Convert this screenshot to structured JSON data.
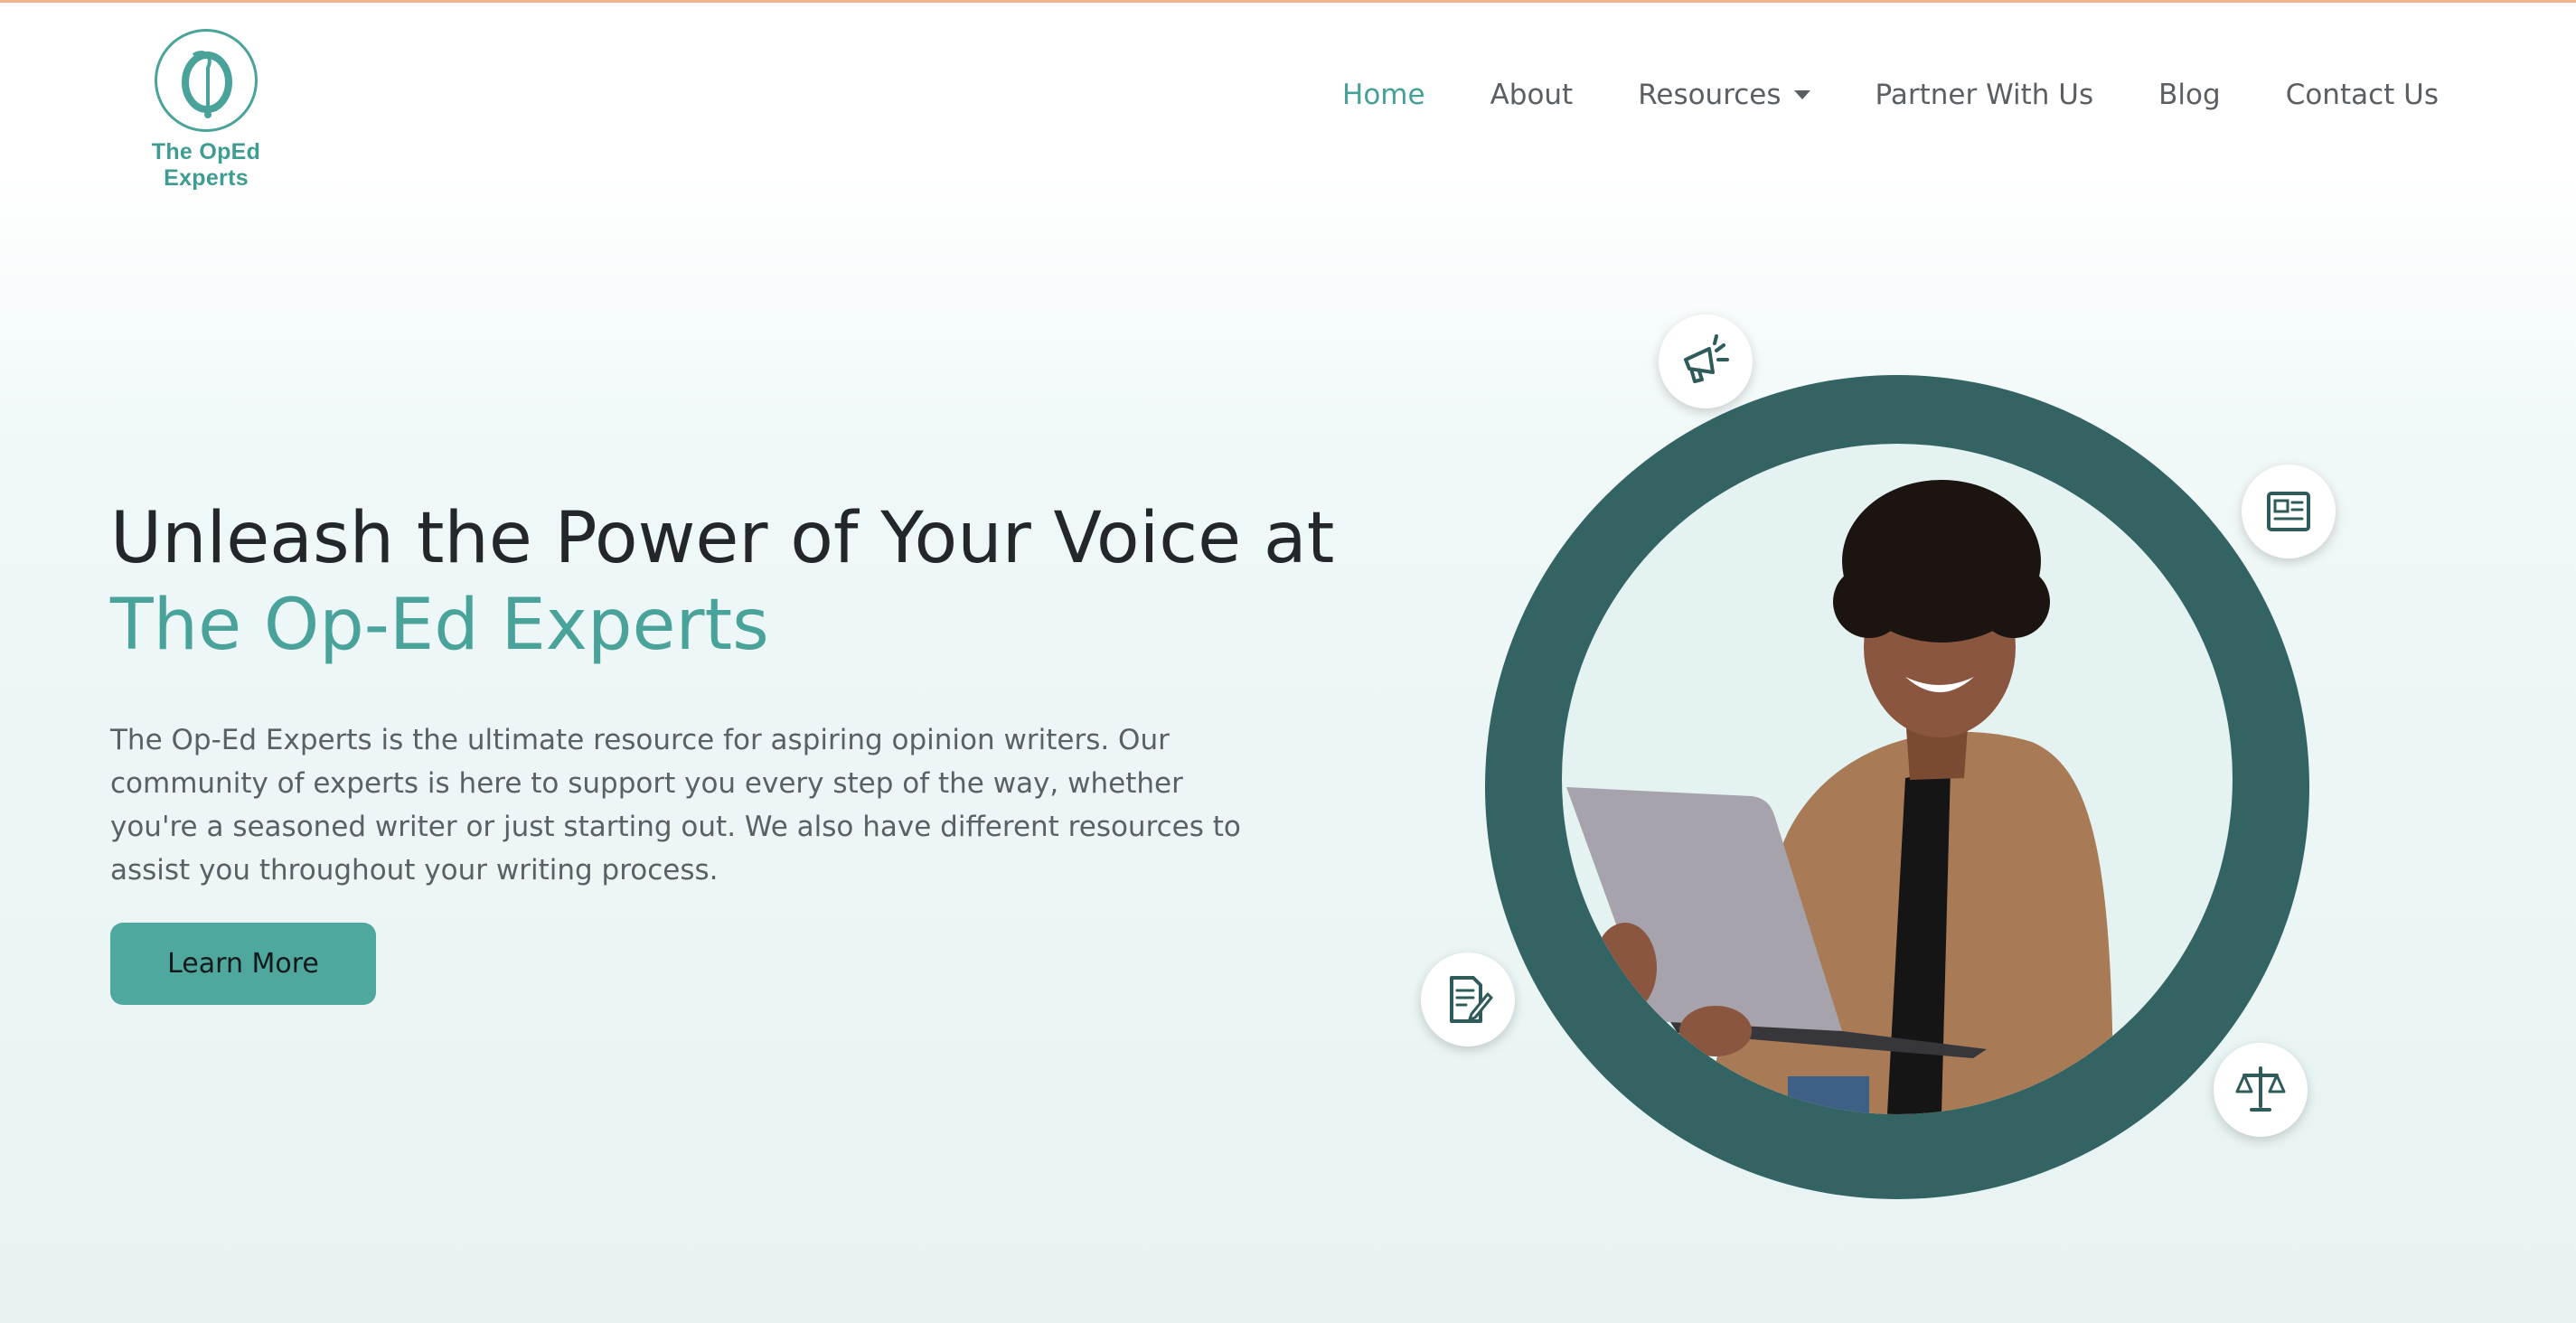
{
  "brand": {
    "name": "The OpEd Experts",
    "logo_icon": "scroll-o-monogram-icon",
    "accent_color": "#4aa39a",
    "dark_color": "#336463",
    "top_border_color": "#f2b48e"
  },
  "nav": {
    "items": [
      {
        "label": "Home",
        "active": true
      },
      {
        "label": "About"
      },
      {
        "label": "Resources",
        "dropdown": true
      },
      {
        "label": "Partner With Us"
      },
      {
        "label": "Blog"
      },
      {
        "label": "Contact Us"
      }
    ]
  },
  "hero": {
    "title_line1": "Unleash the Power of Your Voice at",
    "title_line2": "The Op-Ed Experts",
    "description": "The Op-Ed Experts is the ultimate resource for aspiring opinion writers. Our community of experts is here to support you every step of the way, whether you're a seasoned writer or just starting out. We also have different resources to assist you throughout your writing process.",
    "cta_label": "Learn More"
  },
  "badges": [
    "megaphone-icon",
    "newspaper-icon",
    "document-pen-icon",
    "scales-icon"
  ]
}
